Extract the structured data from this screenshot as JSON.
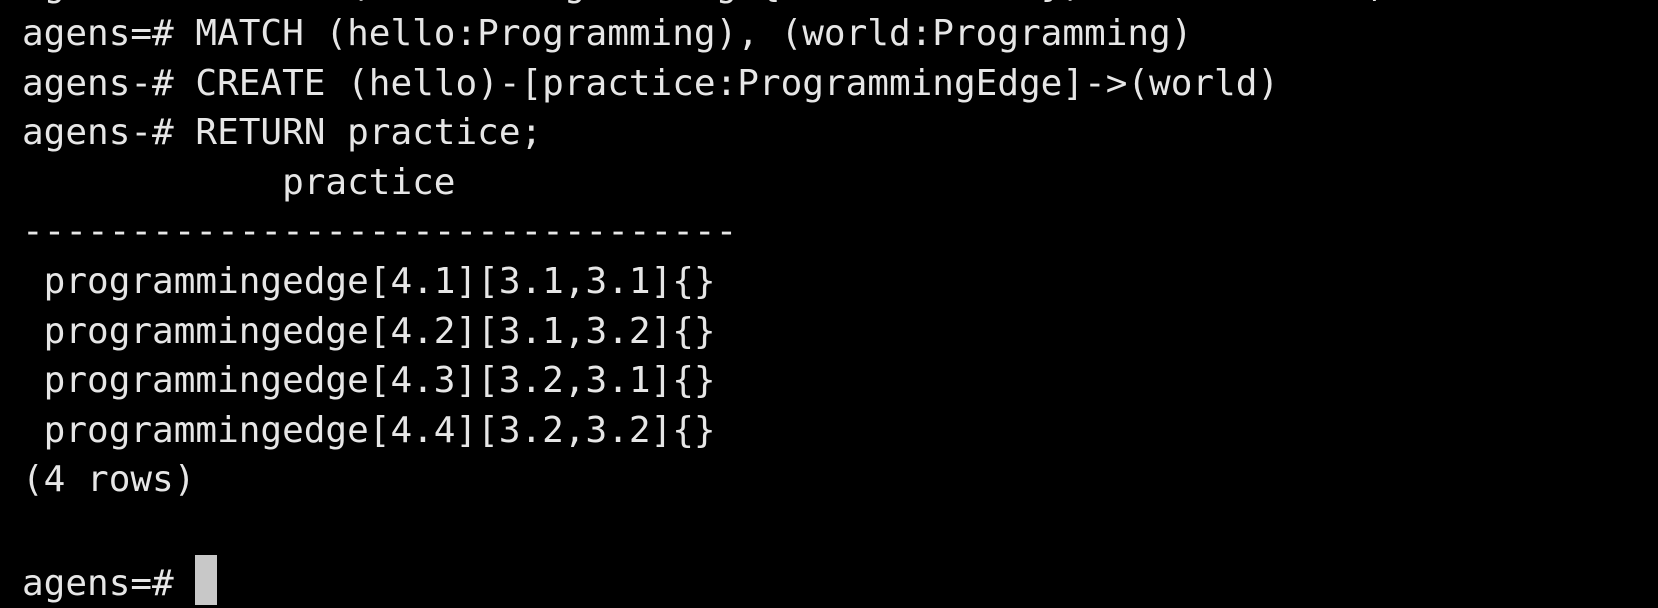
{
  "terminal": {
    "partial_top_line": "agens=# CREATE (world:Programming {name:'World'}) RETURN world; ",
    "lines": [
      "agens=# MATCH (hello:Programming), (world:Programming)",
      "agens-# CREATE (hello)-[practice:ProgrammingEdge]->(world)",
      "agens-# RETURN practice;",
      "            practice",
      "---------------------------------",
      " programmingedge[4.1][3.1,3.1]{}",
      " programmingedge[4.2][3.1,3.2]{}",
      " programmingedge[4.3][3.2,3.1]{}",
      " programmingedge[4.4][3.2,3.2]{}",
      "(4 rows)",
      ""
    ],
    "prompt": "agens=# "
  },
  "colors": {
    "background": "#000000",
    "foreground": "#e6e6e6",
    "cursor": "#c8c8c8"
  }
}
